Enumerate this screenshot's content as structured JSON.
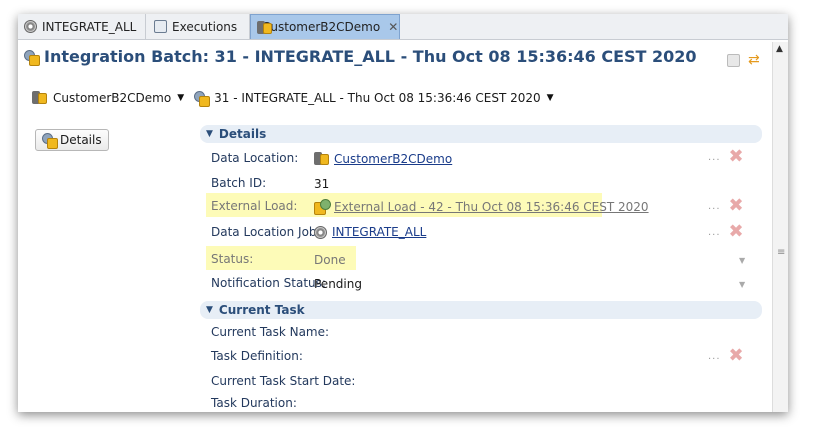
{
  "tabs": [
    {
      "label": "INTEGRATE_ALL",
      "icon": "gear-icon"
    },
    {
      "label": "Executions",
      "icon": "executions-icon"
    },
    {
      "label": "CustomerB2CDemo",
      "icon": "data-location-icon",
      "active": true,
      "close": "✕"
    }
  ],
  "header": {
    "title": "Integration Batch: 31 - INTEGRATE_ALL - Thu Oct 08 15:36:46 CEST 2020"
  },
  "breadcrumb": {
    "location": "CustomerB2CDemo",
    "batch": "31 - INTEGRATE_ALL - Thu Oct 08 15:36:46 CEST 2020"
  },
  "details_button": "Details",
  "sections": {
    "details": {
      "title": "Details",
      "rows": {
        "data_location": {
          "label": "Data Location:",
          "value": "CustomerB2CDemo"
        },
        "batch_id": {
          "label": "Batch ID:",
          "value": "31"
        },
        "external_load": {
          "label": "External Load:",
          "value": "External Load - 42 - Thu Oct 08 15:36:46 CEST 2020"
        },
        "data_location_job": {
          "label": "Data Location Job:",
          "value": "INTEGRATE_ALL"
        },
        "status": {
          "label": "Status:",
          "value": "Done"
        },
        "notification_status": {
          "label": "Notification Status:",
          "value": "Pending"
        }
      }
    },
    "current_task": {
      "title": "Current Task",
      "rows": {
        "name": {
          "label": "Current Task Name:"
        },
        "definition": {
          "label": "Task Definition:"
        },
        "start_date": {
          "label": "Current Task Start Date:"
        },
        "duration": {
          "label": "Task Duration:"
        }
      }
    }
  },
  "glyphs": {
    "dots": "...",
    "remove": "✖",
    "dropdown": "▼",
    "expanded": "▼",
    "sync": "⇄",
    "scroll_up": "▲",
    "grip": "≡"
  },
  "colors": {
    "title": "#2b4e7a",
    "highlight": "#fdfbb8",
    "active_tab": "#a9c8ea",
    "remove": "#e8a9a9"
  }
}
